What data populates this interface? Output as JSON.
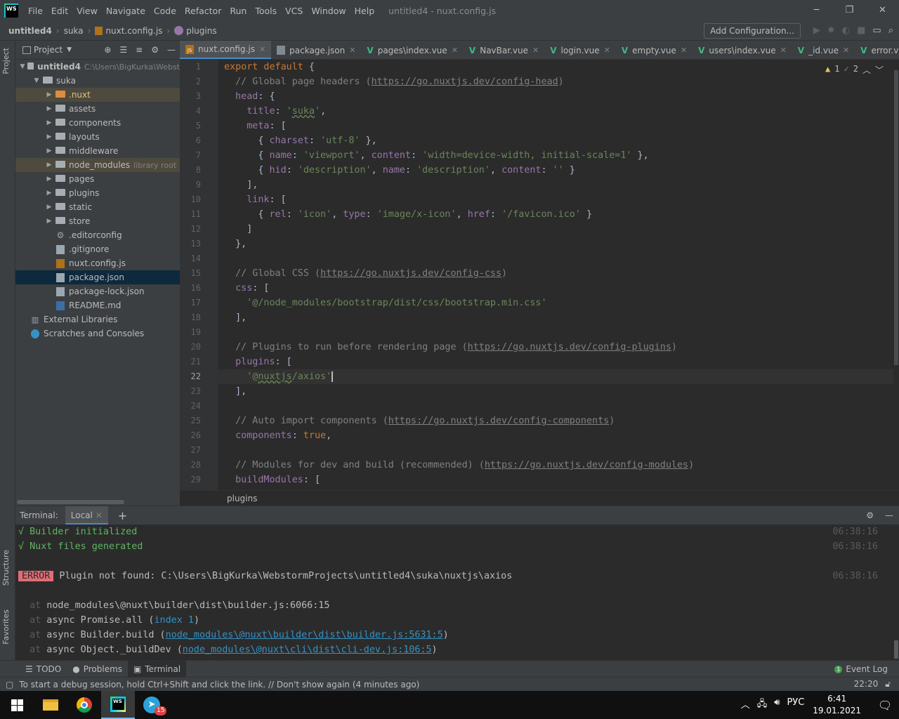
{
  "titlebar": {
    "menu": [
      "File",
      "Edit",
      "View",
      "Navigate",
      "Code",
      "Refactor",
      "Run",
      "Tools",
      "VCS",
      "Window",
      "Help"
    ],
    "title": "untitled4 - nuxt.config.js",
    "minimize": "─",
    "restore": "❐",
    "close": "✕"
  },
  "navbar": {
    "crumbs": [
      "untitled4",
      "suka",
      "nuxt.config.js",
      "plugins"
    ],
    "add_config": "Add Configuration..."
  },
  "project": {
    "title": "Project",
    "tree": [
      {
        "label": "untitled4",
        "suffix": "C:\\Users\\BigKurka\\Webst",
        "indent": 0,
        "type": "folder",
        "open": true
      },
      {
        "label": "suka",
        "indent": 1,
        "type": "folder",
        "open": true
      },
      {
        "label": ".nuxt",
        "indent": 2,
        "type": "folder-orange",
        "collapsed": true,
        "hl": "nuxt"
      },
      {
        "label": "assets",
        "indent": 2,
        "type": "folder",
        "collapsed": true
      },
      {
        "label": "components",
        "indent": 2,
        "type": "folder",
        "collapsed": true
      },
      {
        "label": "layouts",
        "indent": 2,
        "type": "folder",
        "collapsed": true
      },
      {
        "label": "middleware",
        "indent": 2,
        "type": "folder",
        "collapsed": true
      },
      {
        "label": "node_modules",
        "suffix": "library root",
        "indent": 2,
        "type": "folder",
        "collapsed": true,
        "hl": "lib"
      },
      {
        "label": "pages",
        "indent": 2,
        "type": "folder",
        "collapsed": true
      },
      {
        "label": "plugins",
        "indent": 2,
        "type": "folder",
        "collapsed": true
      },
      {
        "label": "static",
        "indent": 2,
        "type": "folder",
        "collapsed": true
      },
      {
        "label": "store",
        "indent": 2,
        "type": "folder",
        "collapsed": true
      },
      {
        "label": ".editorconfig",
        "indent": 2,
        "type": "gear"
      },
      {
        "label": ".gitignore",
        "indent": 2,
        "type": "file"
      },
      {
        "label": "nuxt.config.js",
        "indent": 2,
        "type": "js"
      },
      {
        "label": "package.json",
        "indent": 2,
        "type": "file",
        "hl": "sel"
      },
      {
        "label": "package-lock.json",
        "indent": 2,
        "type": "file"
      },
      {
        "label": "README.md",
        "indent": 2,
        "type": "md"
      },
      {
        "label": "External Libraries",
        "indent": 0,
        "type": "lib"
      },
      {
        "label": "Scratches and Consoles",
        "indent": 0,
        "type": "scratch"
      }
    ]
  },
  "tabs": [
    {
      "label": "nuxt.config.js",
      "icon": "js",
      "active": true
    },
    {
      "label": "package.json",
      "icon": "json"
    },
    {
      "label": "pages\\index.vue",
      "icon": "vue"
    },
    {
      "label": "NavBar.vue",
      "icon": "vue"
    },
    {
      "label": "login.vue",
      "icon": "vue"
    },
    {
      "label": "empty.vue",
      "icon": "vue"
    },
    {
      "label": "users\\index.vue",
      "icon": "vue"
    },
    {
      "label": "_id.vue",
      "icon": "vue"
    },
    {
      "label": "error.vue",
      "icon": "vue"
    }
  ],
  "inspections": {
    "warnings": "1",
    "ok": "2"
  },
  "code_lines": [
    "1",
    "2",
    "3",
    "4",
    "5",
    "6",
    "7",
    "8",
    "9",
    "10",
    "11",
    "12",
    "13",
    "14",
    "15",
    "16",
    "17",
    "18",
    "19",
    "20",
    "21",
    "22",
    "23",
    "24",
    "25",
    "26",
    "27",
    "28",
    "29"
  ],
  "breadcrumb_bottom": "plugins",
  "terminal": {
    "label": "Terminal:",
    "tab": "Local",
    "lines": {
      "l1": "√ Builder initialized",
      "l2": "√ Nuxt files generated",
      "err_badge": "ERROR",
      "err_msg": "Plugin not found: C:\\Users\\BigKurka\\WebstormProjects\\untitled4\\suka\\nuxtjs\\axios",
      "ts": "06:38:16"
    }
  },
  "toolwindows": {
    "todo": "TODO",
    "problems": "Problems",
    "terminal": "Terminal",
    "eventlog": "Event Log"
  },
  "status": {
    "message": "To start a debug session, hold Ctrl+Shift and click the link. // Don't show again (4 minutes ago)",
    "time": "22:20"
  },
  "taskbar": {
    "telegram_badge": "15",
    "lang": "РУС",
    "clock_time": "6:41",
    "clock_date": "19.01.2021"
  },
  "vertical_tabs": {
    "project": "Project",
    "structure": "Structure",
    "favorites": "Favorites"
  }
}
